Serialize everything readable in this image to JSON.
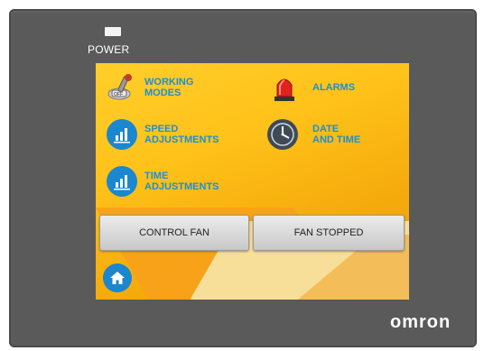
{
  "device": {
    "power_label": "POWER",
    "brand": "omron"
  },
  "menu": {
    "working_modes": "WORKING\nMODES",
    "alarms": "ALARMS",
    "speed_adjustments": "SPEED\nADJUSTMENTS",
    "date_and_time": "DATE\nAND TIME",
    "time_adjustments": "TIME\nADJUSTMENTS"
  },
  "buttons": {
    "control_fan": "CONTROL FAN",
    "fan_status": "FAN STOPPED"
  },
  "icons": {
    "working_modes": "toggle-switch-icon",
    "alarms": "siren-icon",
    "speed_adjustments": "bar-graph-icon",
    "date_and_time": "clock-icon",
    "time_adjustments": "bar-graph-icon",
    "home": "home-icon"
  },
  "colors": {
    "accent": "#1a87cf",
    "screen": "#ffc21a",
    "bezel": "#5a5a5a"
  }
}
